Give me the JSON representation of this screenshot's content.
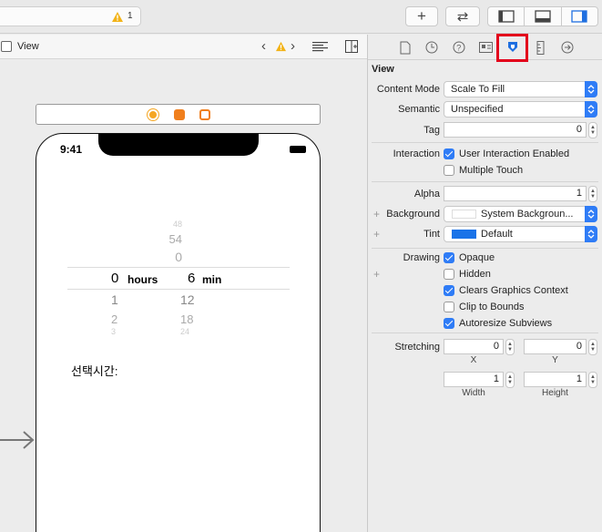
{
  "toolbar": {
    "status_count": "1",
    "add_symbol": "+",
    "swap_symbol": "⇄"
  },
  "editor": {
    "title": "View"
  },
  "device": {
    "time": "9:41",
    "picker": {
      "hours_above": [
        "48",
        "54",
        "0"
      ],
      "mins_above": [],
      "selected_hours": "0",
      "hours_unit": "hours",
      "selected_min": "6",
      "min_unit": "min",
      "hours_below": [
        "1",
        "2",
        "3"
      ],
      "mins_below": [
        "12",
        "18",
        "24"
      ]
    },
    "selected_time_label": "선택시간:"
  },
  "inspector": {
    "section_title": "View",
    "content_mode": {
      "label": "Content Mode",
      "value": "Scale To Fill"
    },
    "semantic": {
      "label": "Semantic",
      "value": "Unspecified"
    },
    "tag": {
      "label": "Tag",
      "value": "0"
    },
    "interaction": {
      "label": "Interaction",
      "user_interaction": "User Interaction Enabled",
      "multiple_touch": "Multiple Touch"
    },
    "alpha": {
      "label": "Alpha",
      "value": "1"
    },
    "background": {
      "label": "Background",
      "value": "System Backgroun..."
    },
    "tint": {
      "label": "Tint",
      "value": "Default",
      "color": "#1a73e8"
    },
    "drawing": {
      "label": "Drawing",
      "opaque": "Opaque",
      "hidden": "Hidden",
      "clears": "Clears Graphics Context",
      "clip": "Clip to Bounds",
      "autoresize": "Autoresize Subviews"
    },
    "stretching": {
      "label": "Stretching",
      "x": "0",
      "y": "0",
      "width": "1",
      "height": "1",
      "x_label": "X",
      "y_label": "Y",
      "width_label": "Width",
      "height_label": "Height"
    }
  },
  "colors": {
    "accent": "#2f7cf6",
    "highlight": "#e3001b",
    "warning": "#f2b318"
  }
}
